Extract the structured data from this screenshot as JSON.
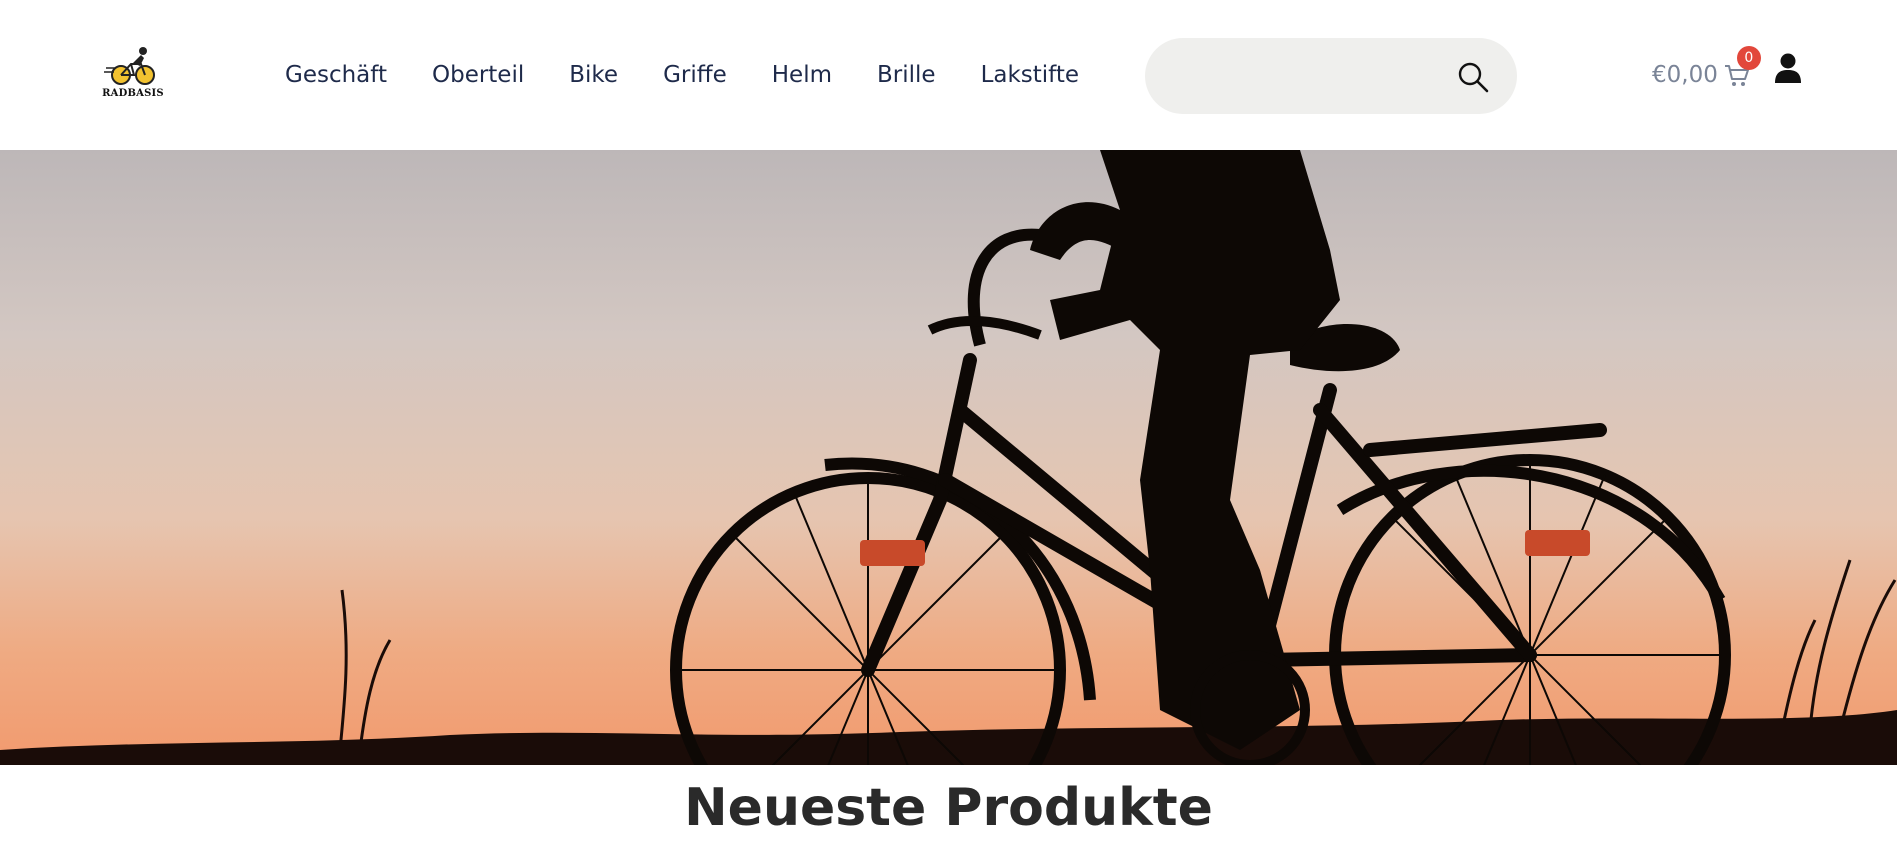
{
  "brand": {
    "name": "RADBASIS",
    "accent": "#e2473b",
    "text_color": "#1e2a4a"
  },
  "nav": {
    "items": [
      {
        "label": "Geschäft"
      },
      {
        "label": "Oberteil"
      },
      {
        "label": "Bike"
      },
      {
        "label": "Griffe"
      },
      {
        "label": "Helm"
      },
      {
        "label": "Brille"
      },
      {
        "label": "Lakstifte"
      }
    ]
  },
  "search": {
    "placeholder": "",
    "icon": "search-icon"
  },
  "cart": {
    "total": "€0,00",
    "count": "0",
    "icon": "cart-icon"
  },
  "account": {
    "icon": "user-icon"
  },
  "hero": {
    "image": "bicycle-silhouette-sunset"
  },
  "products": {
    "title": "Neueste Produkte"
  }
}
